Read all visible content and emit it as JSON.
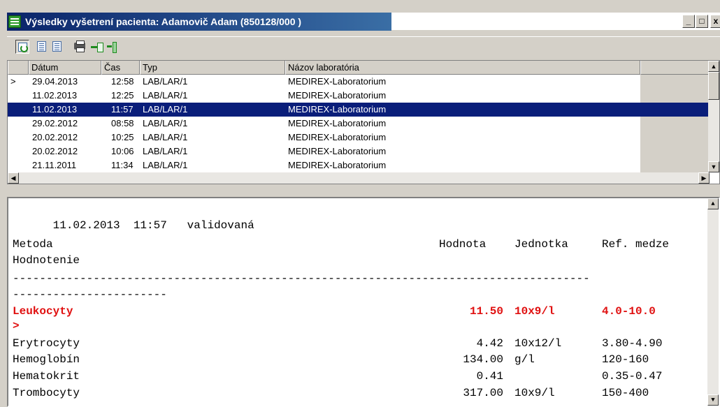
{
  "window": {
    "title": "Výsledky vyšetrení pacienta: Adamovič Adam (850128/000 )",
    "buttons": {
      "minimize": "_",
      "maximize": "□",
      "close": "x"
    }
  },
  "toolbar": {
    "icons": [
      "refresh-icon",
      "list-expand-icon",
      "list-collapse-icon",
      "print-icon",
      "add-icon",
      "exit-icon"
    ]
  },
  "grid": {
    "columns": [
      "",
      "Dátum",
      "Čas",
      "Typ",
      "Názov laboratória"
    ],
    "rows": [
      {
        "marker": ">",
        "date": "29.04.2013",
        "time": "12:58",
        "type": "LAB/LAR/1",
        "lab": "MEDIREX-Laboratorium",
        "selected": false
      },
      {
        "marker": "",
        "date": "11.02.2013",
        "time": "12:25",
        "type": "LAB/LAR/1",
        "lab": "MEDIREX-Laboratorium",
        "selected": false
      },
      {
        "marker": "",
        "date": "11.02.2013",
        "time": "11:57",
        "type": "LAB/LAR/1",
        "lab": "MEDIREX-Laboratorium",
        "selected": true
      },
      {
        "marker": "",
        "date": "29.02.2012",
        "time": "08:58",
        "type": "LAB/LAR/1",
        "lab": "MEDIREX-Laboratorium",
        "selected": false
      },
      {
        "marker": "",
        "date": "20.02.2012",
        "time": "10:25",
        "type": "LAB/LAR/1",
        "lab": "MEDIREX-Laboratorium",
        "selected": false
      },
      {
        "marker": "",
        "date": "20.02.2012",
        "time": "10:06",
        "type": "LAB/LAR/1",
        "lab": "MEDIREX-Laboratorium",
        "selected": false
      },
      {
        "marker": "",
        "date": "21.11.2011",
        "time": "11:34",
        "type": "LAB/LAR/1",
        "lab": "MEDIREX-Laboratorium",
        "selected": false
      }
    ]
  },
  "detail": {
    "header": {
      "date": "11.02.2013",
      "time": "11:57",
      "status": "validovaná"
    },
    "columns": {
      "method": "Metoda",
      "value": "Hodnota",
      "unit": "Jednotka",
      "ref": "Ref. medze",
      "evaluation": "Hodnotenie"
    },
    "separator1": "--------------------------------------------------------------------------------------",
    "separator2": "-----------------------",
    "results": [
      {
        "name": "Leukocyty",
        "value": "11.50",
        "unit": "10x9/l",
        "ref": "4.0-10.0",
        "flag": ">",
        "abnormal": true
      },
      {
        "name": "Erytrocyty",
        "value": "4.42",
        "unit": "10x12/l",
        "ref": "3.80-4.90",
        "flag": "",
        "abnormal": false
      },
      {
        "name": "Hemoglobín",
        "value": "134.00",
        "unit": "g/l",
        "ref": "120-160",
        "flag": "",
        "abnormal": false
      },
      {
        "name": "Hematokrit",
        "value": "0.41",
        "unit": "",
        "ref": "0.35-0.47",
        "flag": "",
        "abnormal": false
      },
      {
        "name": "Trombocyty",
        "value": "317.00",
        "unit": "10x9/l",
        "ref": "150-400",
        "flag": "",
        "abnormal": false
      }
    ]
  },
  "colors": {
    "title_active": "#0a246a",
    "selection": "#0a1e7a",
    "abnormal": "#e01010"
  }
}
